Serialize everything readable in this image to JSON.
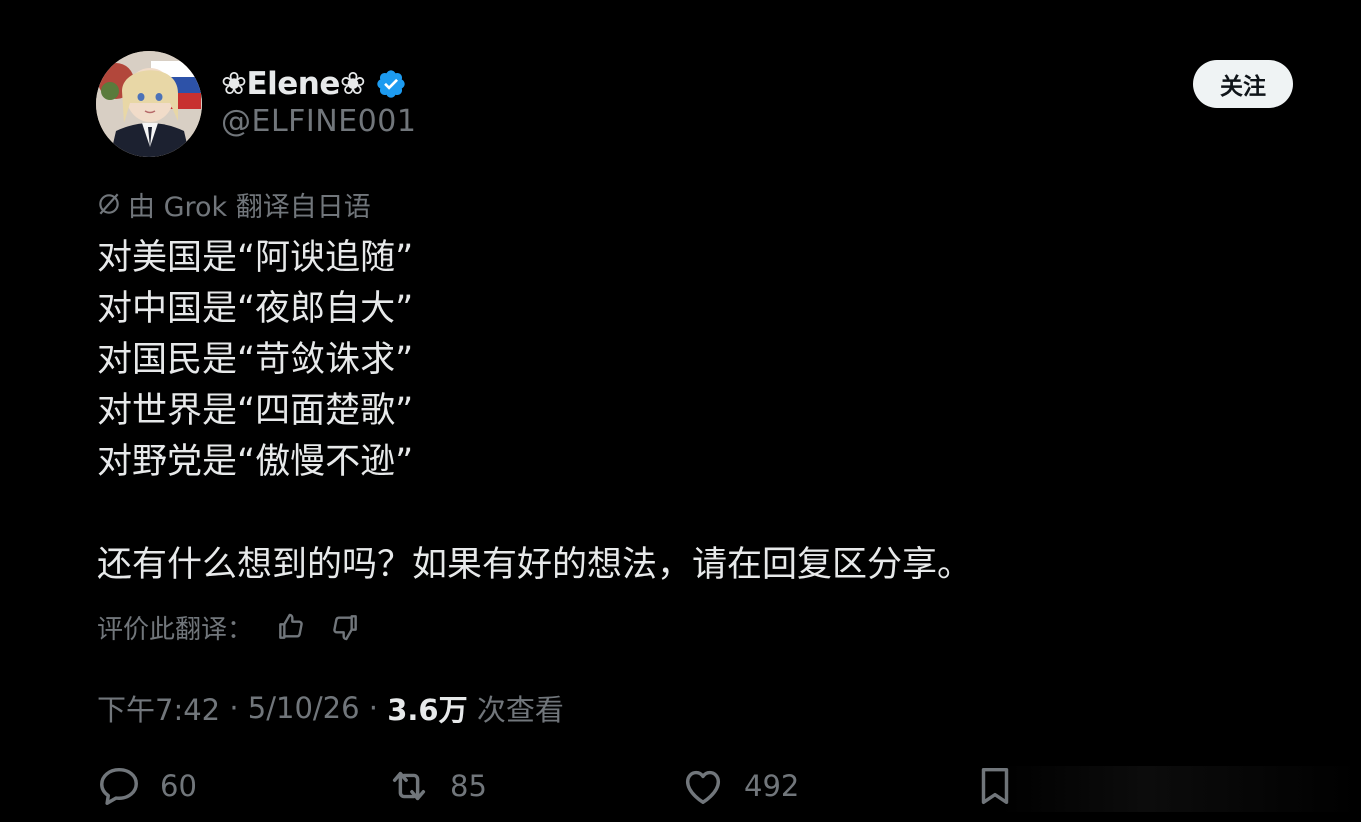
{
  "author": {
    "display_name": "❀Elene❀",
    "handle": "@ELFINE001",
    "verified": true
  },
  "follow_label": "关注",
  "translation_note": "由 Grok 翻译自日语",
  "tweet_lines": [
    "对美国是“阿谀追随”",
    "对中国是“夜郎自大”",
    "对国民是“苛敛诛求”",
    "对世界是“四面楚歌”",
    "对野党是“傲慢不逊”",
    "",
    "还有什么想到的吗？如果有好的想法，请在回复区分享。"
  ],
  "rate_translation_label": "评价此翻译：",
  "meta": {
    "time": "下午7:42",
    "separator": " · ",
    "date": "5/10/26",
    "views_count": "3.6万",
    "views_label": " 次查看"
  },
  "actions": {
    "replies": "60",
    "reposts": "85",
    "likes": "492"
  },
  "colors": {
    "background": "#000000",
    "text": "#e7e9ea",
    "muted": "#71767b",
    "verified_blue": "#1d9bf0",
    "follow_bg": "#eff3f4"
  },
  "icons": {
    "verified": "verified-badge-icon",
    "grok": "grok-icon",
    "thumbs_up": "thumbs-up-icon",
    "thumbs_down": "thumbs-down-icon",
    "reply": "reply-icon",
    "repost": "repost-icon",
    "like": "like-icon",
    "bookmark": "bookmark-icon"
  }
}
